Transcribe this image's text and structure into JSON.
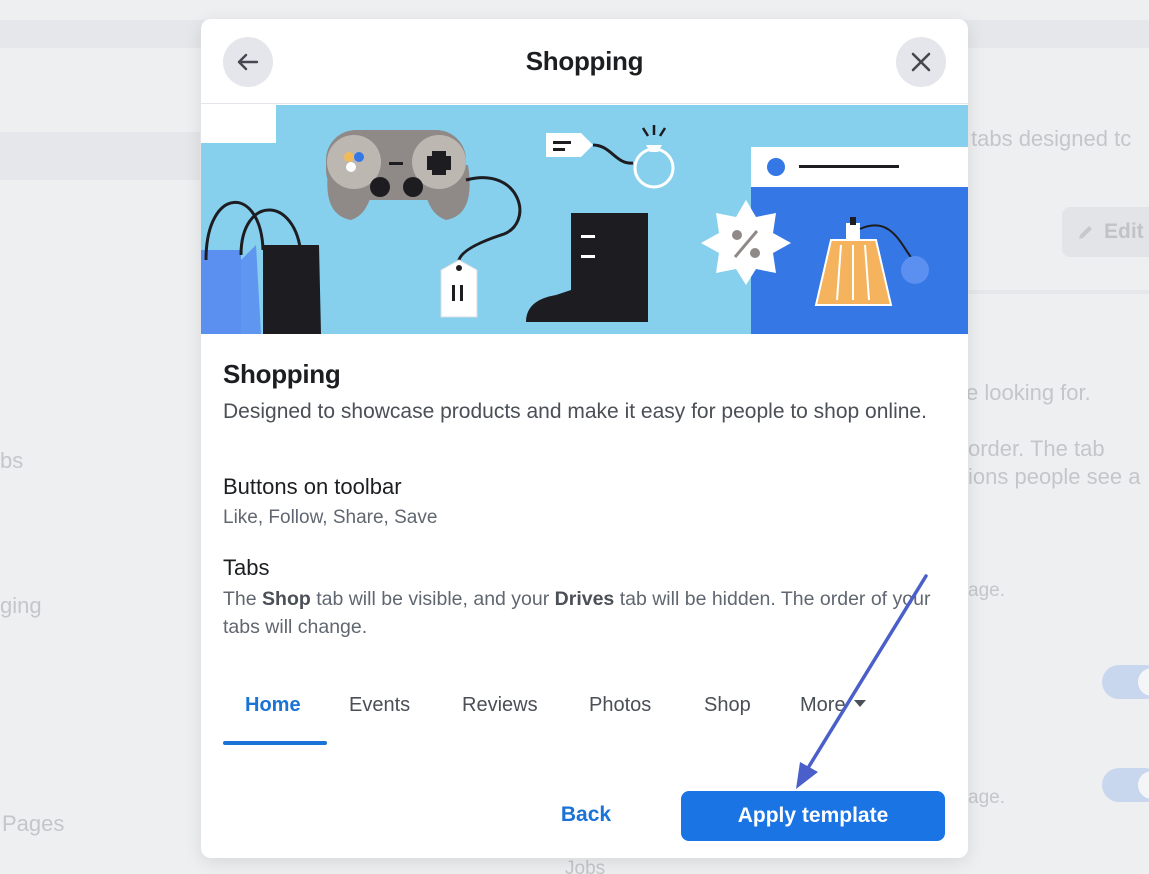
{
  "background": {
    "text_fragments": {
      "tabs_designed": "l tabs designed tc",
      "edit": "Edit",
      "looking_for": "e looking for.",
      "order": "order. The tab",
      "options": "ions people see a",
      "left_tabs": "bs",
      "left_messaging": "ging",
      "page_1": "age.",
      "page_2": "age.",
      "left_pages": "Pages",
      "jobs": "Jobs"
    }
  },
  "modal": {
    "title": "Shopping",
    "template": {
      "name": "Shopping",
      "description": "Designed to showcase products and make it easy for people to shop online."
    },
    "toolbar_section": {
      "heading": "Buttons on toolbar",
      "value": "Like, Follow, Share, Save"
    },
    "tabs_section": {
      "heading": "Tabs",
      "desc_part1": "The ",
      "shop_bold": "Shop",
      "desc_part2": " tab will be visible, and your ",
      "drives_bold": "Drives",
      "desc_part3": " tab will be hidden. The order of your tabs will change."
    },
    "preview_tabs": [
      {
        "label": "Home"
      },
      {
        "label": "Events"
      },
      {
        "label": "Reviews"
      },
      {
        "label": "Photos"
      },
      {
        "label": "Shop"
      },
      {
        "label": "More"
      }
    ],
    "footer": {
      "back_label": "Back",
      "apply_label": "Apply template"
    },
    "icons": {
      "back": "arrow-left-icon",
      "close": "close-icon",
      "more_caret": "caret-down-icon"
    }
  },
  "colors": {
    "accent": "#1b74e4",
    "link": "#1a73d6",
    "banner_sky": "#86d0ee",
    "banner_blue": "#3577e5",
    "annotation_arrow": "#4a5fc9"
  }
}
